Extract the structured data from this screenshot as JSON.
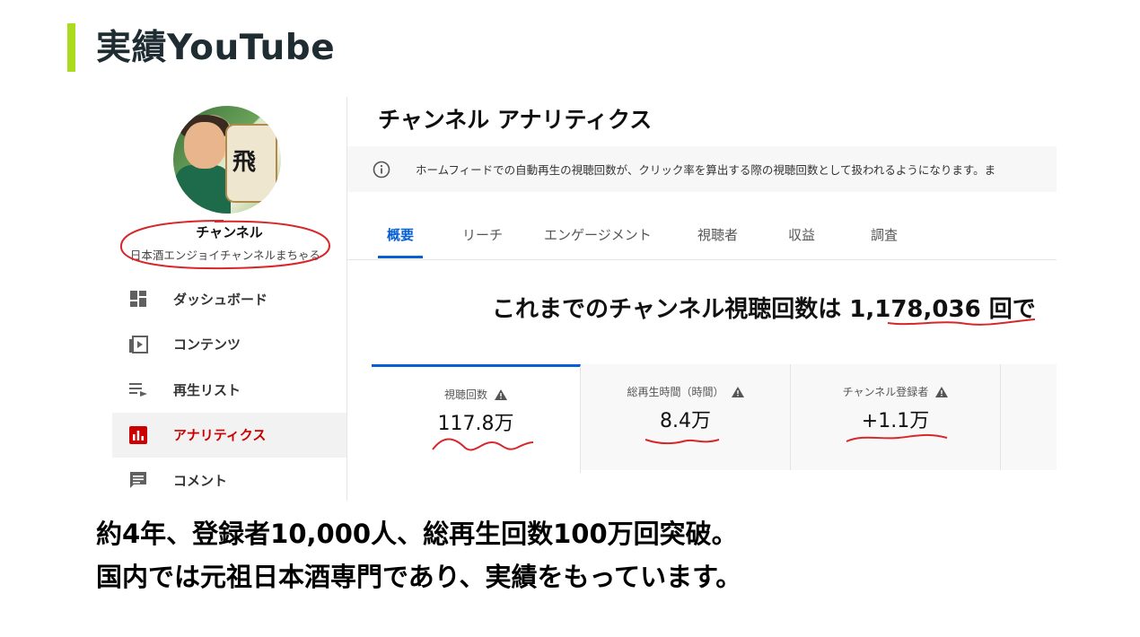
{
  "slide": {
    "title": "実績YouTube",
    "accent_color": "#aadb1e",
    "lines": [
      "約4年、登録者10,000人、総再生回数100万回突破。",
      "国内では元祖日本酒専門であり、実績をもっています。"
    ]
  },
  "sidebar": {
    "avatar_text": "飛",
    "channel_label": "チャンネル",
    "channel_name": "日本酒エンジョイチャンネルまちゃる",
    "items": [
      {
        "label": "ダッシュボード",
        "icon": "dashboard-icon"
      },
      {
        "label": "コンテンツ",
        "icon": "content-icon"
      },
      {
        "label": "再生リスト",
        "icon": "playlist-icon"
      },
      {
        "label": "アナリティクス",
        "icon": "analytics-icon",
        "active": true
      },
      {
        "label": "コメント",
        "icon": "comment-icon"
      }
    ]
  },
  "main": {
    "title": "チャンネル アナリティクス",
    "notice": "ホームフィードでの自動再生の視聴回数が、クリック率を算出する際の視聴回数として扱われるようになります。ま",
    "tabs": [
      {
        "label": "概要",
        "active": true
      },
      {
        "label": "リーチ"
      },
      {
        "label": "エンゲージメント"
      },
      {
        "label": "視聴者"
      },
      {
        "label": "収益"
      },
      {
        "label": "調査"
      }
    ],
    "headline": "これまでのチャンネル視聴回数は 1,178,036 回で",
    "cards": [
      {
        "label": "視聴回数",
        "value": "117.8万",
        "active": true
      },
      {
        "label": "総再生時間（時間）",
        "value": "8.4万"
      },
      {
        "label": "チャンネル登録者",
        "value": "+1.1万"
      }
    ],
    "accent_color": "#065fd4",
    "annotation_color": "#d8262a"
  }
}
